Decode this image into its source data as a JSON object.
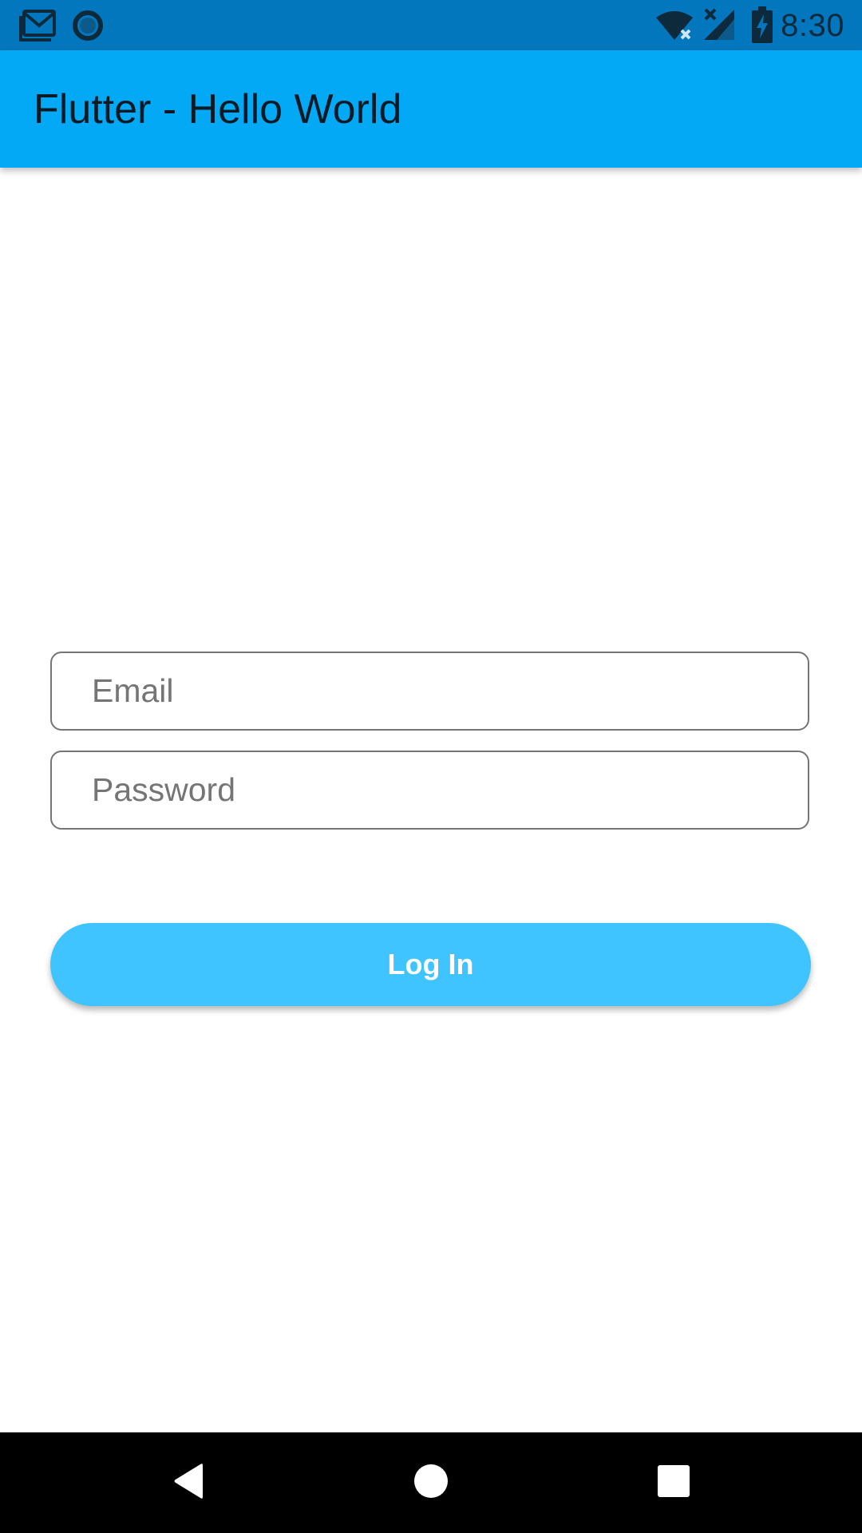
{
  "status_bar": {
    "time": "8:30",
    "background": "#0277bd",
    "icons": [
      "gmail-icon",
      "circle-notification-icon",
      "wifi-no-internet-icon",
      "cellular-no-signal-icon",
      "battery-charging-icon"
    ]
  },
  "app_bar": {
    "title": "Flutter - Hello World",
    "background": "#03a9f4"
  },
  "form": {
    "email": {
      "value": "",
      "placeholder": "Email"
    },
    "password": {
      "value": "",
      "placeholder": "Password"
    },
    "login_label": "Log In",
    "login_color": "#40c4ff"
  },
  "nav_bar": {
    "icons": [
      "back-icon",
      "home-icon",
      "recents-icon"
    ]
  }
}
